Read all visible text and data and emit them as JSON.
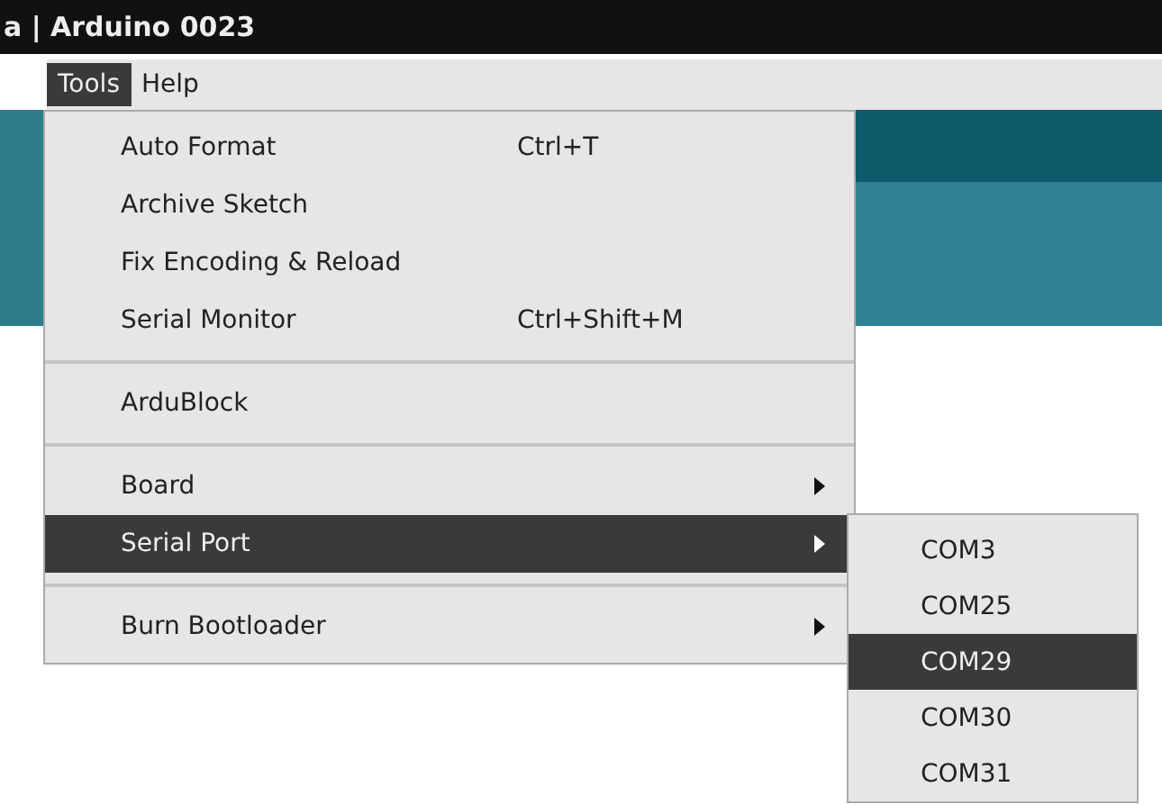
{
  "window": {
    "title": "a | Arduino 0023"
  },
  "menubar": [
    {
      "label": "Tools",
      "selected": true
    },
    {
      "label": "Help",
      "selected": false
    }
  ],
  "tools_menu": {
    "sections": [
      [
        {
          "label": "Auto Format",
          "shortcut": "Ctrl+T",
          "has_submenu": false,
          "selected": false
        },
        {
          "label": "Archive Sketch",
          "has_submenu": false,
          "selected": false
        },
        {
          "label": "Fix Encoding & Reload",
          "has_submenu": false,
          "selected": false
        },
        {
          "label": "Serial Monitor",
          "shortcut": "Ctrl+Shift+M",
          "has_submenu": false,
          "selected": false
        }
      ],
      [
        {
          "label": "ArduBlock",
          "has_submenu": false,
          "selected": false
        }
      ],
      [
        {
          "label": "Board",
          "has_submenu": true,
          "selected": false
        },
        {
          "label": "Serial Port",
          "has_submenu": true,
          "selected": true
        }
      ],
      [
        {
          "label": "Burn Bootloader",
          "has_submenu": true,
          "selected": false
        }
      ]
    ]
  },
  "serial_port_submenu": [
    {
      "label": "COM3",
      "selected": false
    },
    {
      "label": "COM25",
      "selected": false
    },
    {
      "label": "COM29",
      "selected": true
    },
    {
      "label": "COM30",
      "selected": false
    },
    {
      "label": "COM31",
      "selected": false
    }
  ]
}
